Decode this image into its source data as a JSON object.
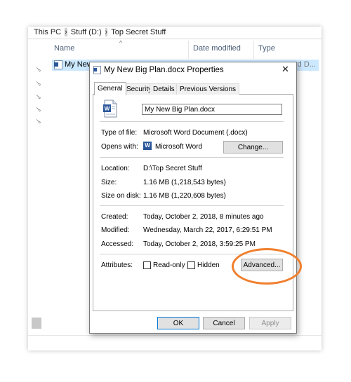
{
  "explorer": {
    "breadcrumb": [
      "This PC",
      "Stuff (D:)",
      "Top Secret Stuff"
    ],
    "columns": [
      "Name",
      "Date modified",
      "Type"
    ],
    "row": {
      "name": "My New",
      "type": "rd D..."
    },
    "pin_glyph": "📌"
  },
  "dialog": {
    "title": "My New Big Plan.docx Properties",
    "close_glyph": "✕",
    "tabs": [
      "General",
      "Security",
      "Details",
      "Previous Versions"
    ],
    "filename": "My New Big Plan.docx",
    "type_label": "Type of file:",
    "type_value": "Microsoft Word Document (.docx)",
    "opens_label": "Opens with:",
    "opens_value": "Microsoft Word",
    "change_button": "Change...",
    "location_label": "Location:",
    "location_value": "D:\\Top Secret Stuff",
    "size_label": "Size:",
    "size_value": "1.16 MB (1,218,543 bytes)",
    "size_disk_label": "Size on disk:",
    "size_disk_value": "1.16 MB (1,220,608 bytes)",
    "created_label": "Created:",
    "created_value": "Today, October 2, 2018, 8 minutes ago",
    "modified_label": "Modified:",
    "modified_value": "Wednesday, March 22, 2017, 6:29:51 PM",
    "accessed_label": "Accessed:",
    "accessed_value": "Today, October 2, 2018, 3:59:25 PM",
    "attributes_label": "Attributes:",
    "readonly_label": "Read-only",
    "hidden_label": "Hidden",
    "advanced_button": "Advanced...",
    "ok_button": "OK",
    "cancel_button": "Cancel",
    "apply_button": "Apply"
  },
  "colors": {
    "highlight": "#f07f2d",
    "selection": "#cce8ff",
    "accent": "#0078d7"
  }
}
